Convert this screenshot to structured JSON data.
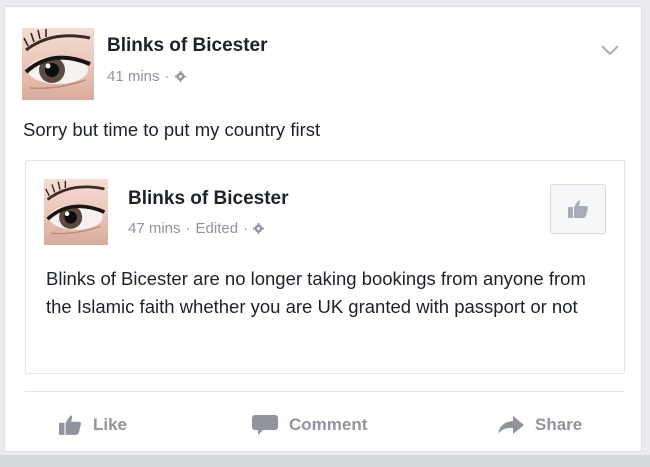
{
  "post": {
    "author": "Blinks of Bicester",
    "time": "41 mins",
    "separator": "·",
    "text": "Sorry but time to put my country first"
  },
  "shared_post": {
    "author": "Blinks of Bicester",
    "time": "47 mins",
    "separator1": "·",
    "edited": "Edited",
    "separator2": "·",
    "text": "Blinks of Bicester are no longer taking bookings from anyone from the Islamic faith whether you are UK granted with passport or not"
  },
  "actions": {
    "like": "Like",
    "comment": "Comment",
    "share": "Share"
  },
  "icons": {
    "privacy": "gear-icon",
    "menu": "chevron-down-icon",
    "like": "thumbs-up-icon",
    "comment": "speech-bubble-icon",
    "share": "share-arrow-icon"
  },
  "colors": {
    "text": "#1d2129",
    "meta": "#90949c",
    "background": "#e9ebee"
  }
}
